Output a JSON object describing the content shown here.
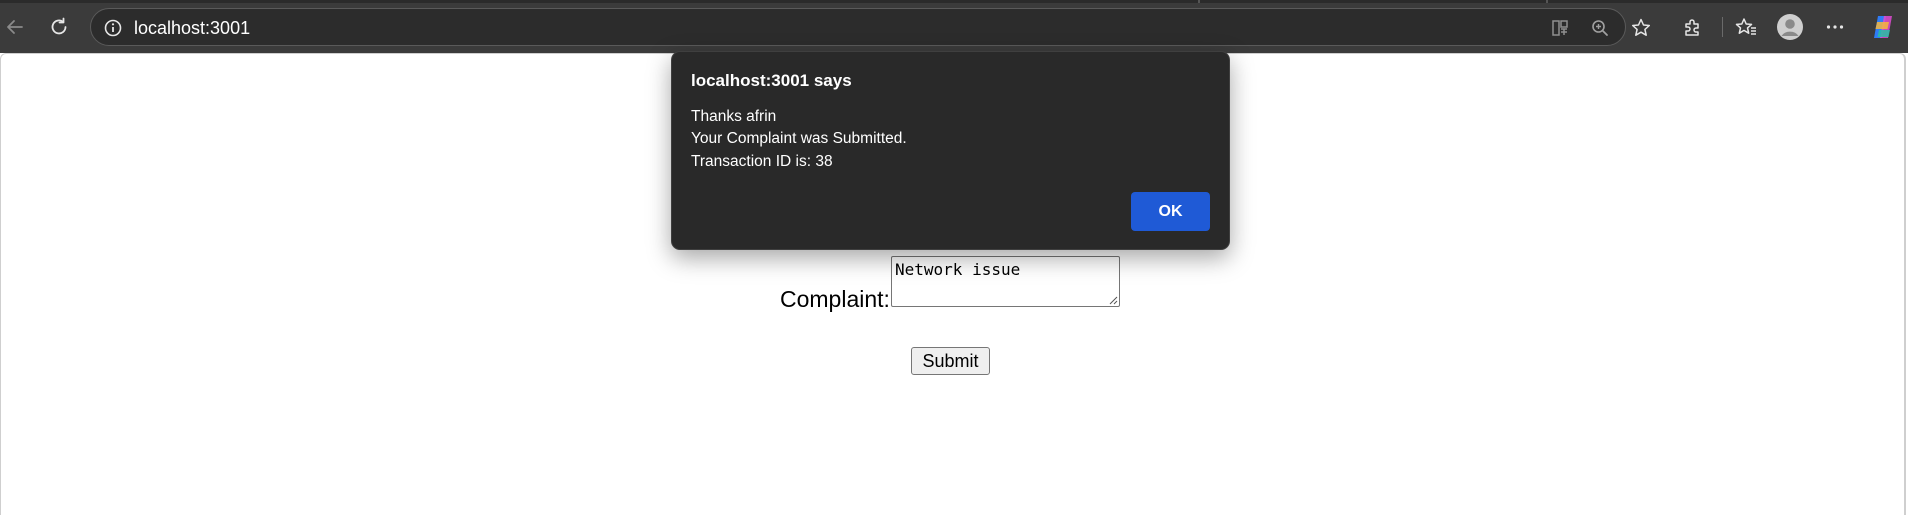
{
  "browser": {
    "url": "localhost:3001",
    "icons": {
      "back": "back-arrow-icon",
      "refresh": "refresh-icon",
      "site_info": "info-icon",
      "reader": "reader-view-icon",
      "zoom": "zoom-icon",
      "favorite": "star-icon",
      "extensions": "puzzle-icon",
      "favorites": "favorites-icon",
      "profile": "profile-icon",
      "more": "more-icon",
      "copilot": "copilot-icon"
    }
  },
  "form": {
    "complaint_label": "Complaint:",
    "complaint_value": "Network issue",
    "submit_label": "Submit"
  },
  "dialog": {
    "title": "localhost:3001 says",
    "lines": [
      "Thanks afrin",
      "Your Complaint was Submitted.",
      "Transaction ID is: 38"
    ],
    "ok_label": "OK"
  },
  "colors": {
    "toolbar": "#3b3b3b",
    "dialog_bg": "#292929",
    "ok_button": "#1f5ad6"
  }
}
